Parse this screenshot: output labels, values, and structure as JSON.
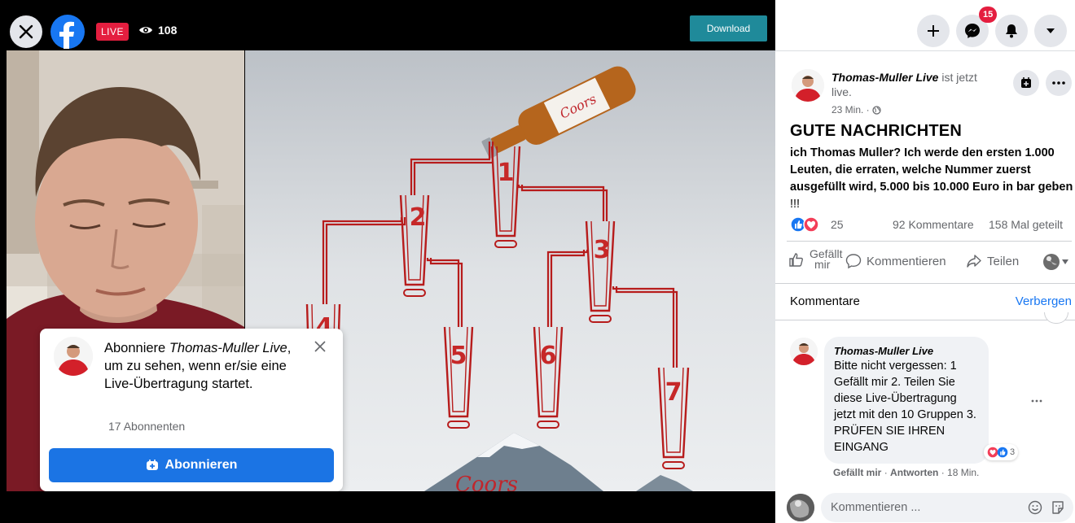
{
  "video": {
    "live_label": "LIVE",
    "viewer_count": "108",
    "download_label": "Download",
    "game_numbers": [
      "1",
      "2",
      "3",
      "4",
      "5",
      "6",
      "7"
    ],
    "accent_red": "#b71c1c"
  },
  "subscribe_card": {
    "text_prefix": "Abonniere ",
    "page_name": "Thomas-Muller Live",
    "text_suffix": ", um zu sehen, wenn er/sie eine Live-Übertragung startet.",
    "subscriber_count": "17 Abonnenten",
    "button_label": "Abonnieren"
  },
  "header": {
    "notification_badge": "15"
  },
  "post": {
    "author": "Thomas-Muller Live",
    "status_text": " ist jetzt live.",
    "time": "23 Min. · ",
    "headline": "GUTE NACHRICHTEN",
    "body_bold": "ich Thomas Muller? Ich werde den ersten 1.000 Leuten, die erraten, welche Nummer zuerst ausgefüllt wird, 5.000 bis 10.000 Euro in bar geben",
    "body_tail": " !!!",
    "reaction_count": "25",
    "comments_count": "92 Kommentare",
    "shares_count": "158 Mal geteilt",
    "like_label_1": "Gefällt",
    "like_label_2": "mir",
    "comment_label": "Kommentieren",
    "share_label": "Teilen"
  },
  "comments": {
    "title": "Kommentare",
    "hide_label": "Verbergen",
    "items": [
      {
        "author": "Thomas-Muller Live",
        "text": "Bitte nicht vergessen: 1 Gefällt mir 2. Teilen Sie diese Live-Übertragung jetzt mit den 10 Gruppen 3. PRÜFEN SIE IHREN EINGANG",
        "reaction_count": "3",
        "like_label": "Gefällt mir",
        "reply_label": "Antworten",
        "time": "18 Min."
      }
    ],
    "composer_placeholder": "Kommentieren ..."
  },
  "colors": {
    "facebook_blue": "#1877f2",
    "live_red": "#e41e3f",
    "download_teal": "#1f8a9a"
  }
}
